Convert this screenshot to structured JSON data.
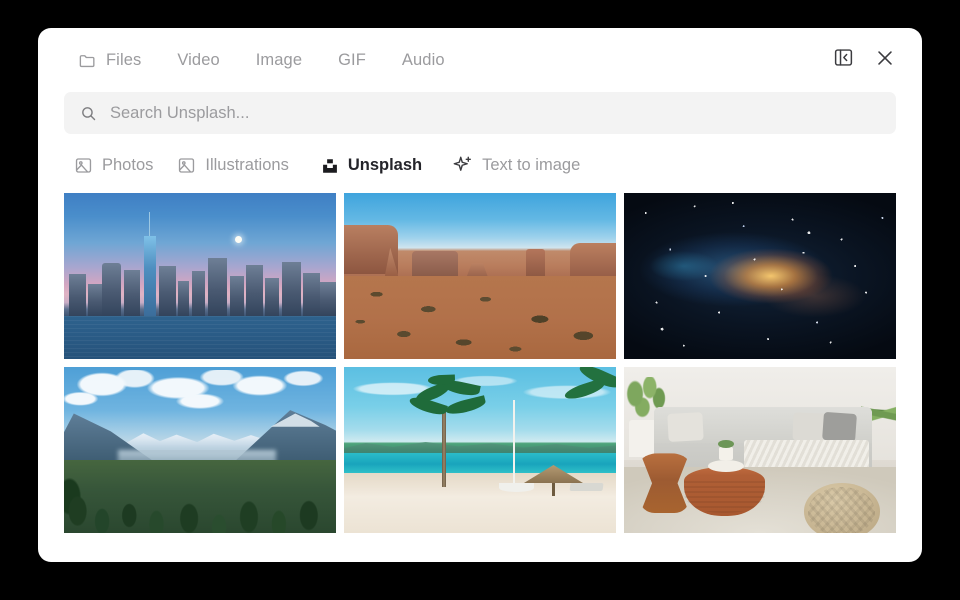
{
  "window": {
    "background_color": "#000000",
    "panel_color": "#ffffff"
  },
  "header": {
    "tabs": [
      {
        "label": "Files",
        "icon": "folder-icon",
        "active": false
      },
      {
        "label": "Video",
        "icon": null,
        "active": false
      },
      {
        "label": "Image",
        "icon": null,
        "active": false
      },
      {
        "label": "GIF",
        "icon": null,
        "active": false
      },
      {
        "label": "Audio",
        "icon": null,
        "active": false
      }
    ],
    "actions": [
      {
        "name": "collapse-panel-button",
        "icon": "panel-collapse-icon"
      },
      {
        "name": "close-button",
        "icon": "close-icon"
      }
    ]
  },
  "search": {
    "icon": "search-icon",
    "placeholder": "Search Unsplash...",
    "value": ""
  },
  "filters": [
    {
      "label": "Photos",
      "icon": "image-icon",
      "active": false
    },
    {
      "label": "Illustrations",
      "icon": "image-icon",
      "active": false
    },
    {
      "label": "Unsplash",
      "icon": "unsplash-icon",
      "active": true
    },
    {
      "label": "Text to image",
      "icon": "sparkle-plus-icon",
      "active": false
    }
  ],
  "gallery": {
    "columns": 3,
    "items": [
      {
        "alt": "New York City skyline at dusk with moon over the Hudson River",
        "theme": "nyc"
      },
      {
        "alt": "Monument Valley desert mesas under a blue sky",
        "theme": "desert"
      },
      {
        "alt": "Milky Way galaxy core glowing orange among blue nebula dust",
        "theme": "galaxy"
      },
      {
        "alt": "Snow capped mountain valley with conifer forest",
        "theme": "mountains"
      },
      {
        "alt": "Tropical white sand beach with palm trees, sailboat and thatched umbrella",
        "theme": "beach"
      },
      {
        "alt": "Scandinavian living room with grey sofa, wooden coffee tables and knit pouf",
        "theme": "living"
      }
    ]
  },
  "colors": {
    "text_muted": "#9b9b9e",
    "text_active": "#24242a",
    "search_field": "#f3f3f3",
    "icon_dark": "#3b3b3f"
  }
}
